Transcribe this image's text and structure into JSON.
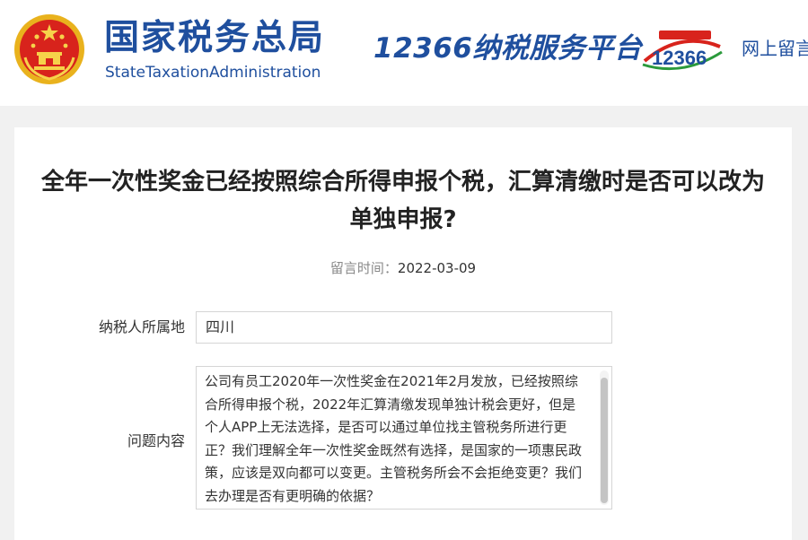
{
  "header": {
    "site_name_cn": "国家税务总局",
    "site_name_en": "StateTaxationAdministration",
    "hotline_title": "12366纳税服务平台",
    "hotline_logo_text": "12366",
    "nav_link": "网上留言",
    "emblem_icon": "national-emblem-icon"
  },
  "question": {
    "title": "全年一次性奖金已经按照综合所得申报个税，汇算清缴时是否可以改为单独申报?",
    "time_label": "留言时间：",
    "time_value": "2022-03-09"
  },
  "form": {
    "location_label": "纳税人所属地",
    "location_value": "四川",
    "content_label": "问题内容",
    "content_value": "公司有员工2020年一次性奖金在2021年2月发放，已经按照综合所得申报个税，2022年汇算清缴发现单独计税会更好，但是个人APP上无法选择，是否可以通过单位找主管税务所进行更正？我们理解全年一次性奖金既然有选择，是国家的一项惠民政策，应该是双向都可以变更。主管税务所会不会拒绝变更？我们去办理是否有更明确的依据？"
  },
  "colors": {
    "brand_blue": "#1f4f9e",
    "emblem_red": "#d8231c",
    "emblem_gold": "#e9b21d",
    "page_bg": "#f1f1f1"
  }
}
